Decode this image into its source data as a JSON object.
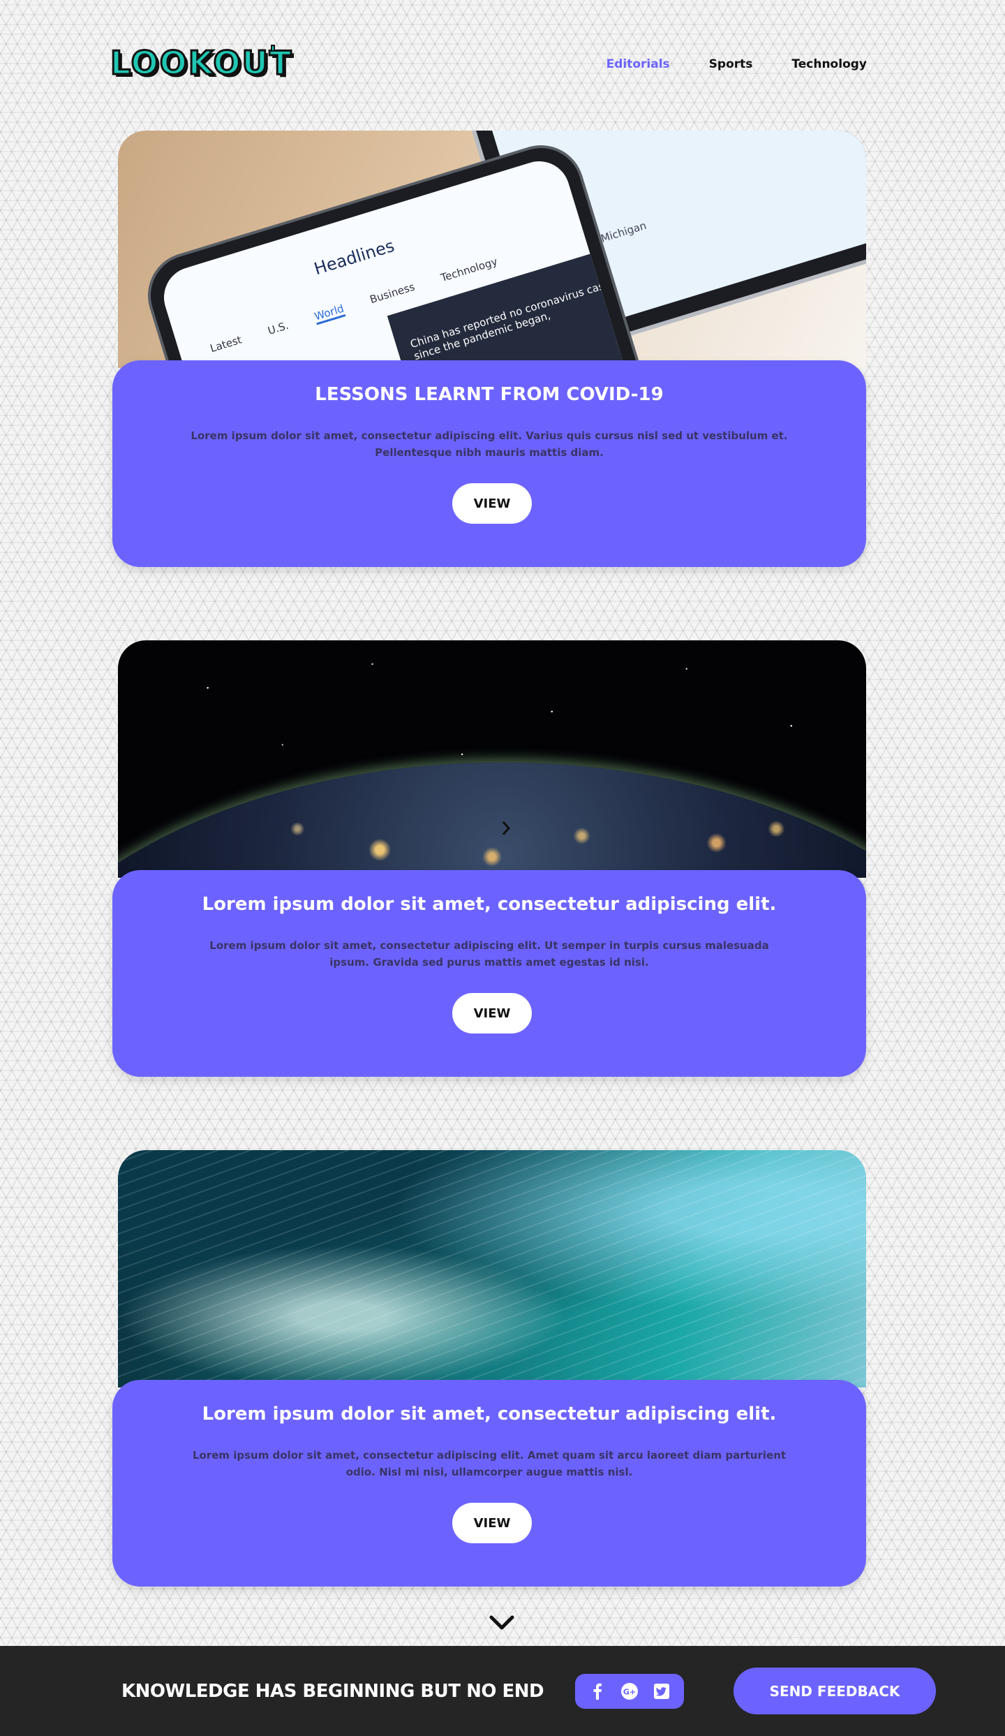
{
  "header": {
    "logo_text": "LOOKOUT",
    "nav": [
      {
        "label": "Editorials",
        "active": true
      },
      {
        "label": "Sports",
        "active": false
      },
      {
        "label": "Technology",
        "active": false
      }
    ]
  },
  "cards": [
    {
      "title": "LESSONS LEARNT  FROM COVID-19",
      "text": "Lorem ipsum dolor sit amet, consectetur adipiscing elit. Varius quis cursus nisl sed ut vestibulum et. Pellentesque nibh mauris mattis diam.",
      "button_label": "VIEW",
      "image": {
        "headline": "Headlines",
        "tabs": [
          "Latest",
          "U.S.",
          "World",
          "Business",
          "Technology"
        ],
        "news_snippet": "China has reported no coronavirus cases since the pandemic began,",
        "tablet_text": "Track Michigan"
      }
    },
    {
      "title": "Lorem ipsum dolor sit amet, consectetur adipiscing elit.",
      "text": "Lorem ipsum dolor sit amet, consectetur adipiscing elit. Ut semper in turpis cursus malesuada ipsum. Gravida sed purus mattis amet egestas id nisi.",
      "button_label": "VIEW"
    },
    {
      "title": "Lorem ipsum dolor sit amet, consectetur adipiscing elit.",
      "text": "Lorem ipsum dolor sit amet, consectetur adipiscing elit. Amet quam sit arcu laoreet diam parturient odio. Nisl mi nisi, ullamcorper augue mattis nisl.",
      "button_label": "VIEW"
    }
  ],
  "footer": {
    "slogan": "KNOWLEDGE  HAS BEGINNING BUT NO  END",
    "social": [
      "facebook-icon",
      "google-plus-icon",
      "twitter-icon"
    ],
    "feedback_label": "SEND FEEDBACK"
  },
  "colors": {
    "accent": "#6c63ff",
    "logo": "#1fc7b3",
    "footer_bg": "#252525"
  }
}
